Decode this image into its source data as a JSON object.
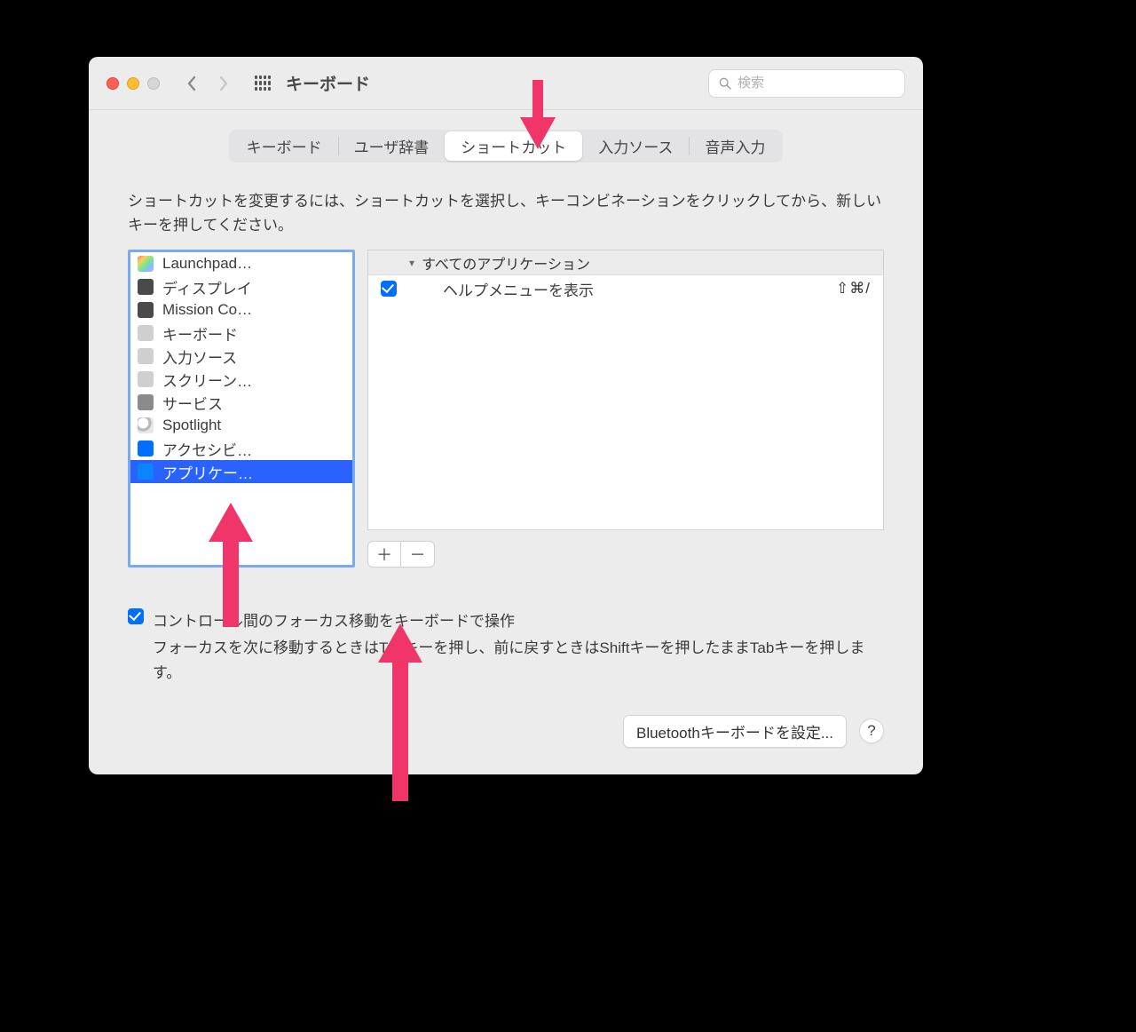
{
  "window": {
    "title": "キーボード",
    "search_placeholder": "検索"
  },
  "tabs": [
    {
      "label": "キーボード",
      "active": false
    },
    {
      "label": "ユーザ辞書",
      "active": false
    },
    {
      "label": "ショートカット",
      "active": true
    },
    {
      "label": "入力ソース",
      "active": false
    },
    {
      "label": "音声入力",
      "active": false
    }
  ],
  "instruction": "ショートカットを変更するには、ショートカットを選択し、キーコンビネーションをクリックしてから、新しいキーを押してください。",
  "sidebar": {
    "items": [
      {
        "label": "Launchpad…",
        "icon": "launchpad-icon",
        "icon_class": "ico-launchpad",
        "selected": false
      },
      {
        "label": "ディスプレイ",
        "icon": "display-icon",
        "icon_class": "ico-display",
        "selected": false
      },
      {
        "label": "Mission Co…",
        "icon": "mission-control-icon",
        "icon_class": "ico-mission",
        "selected": false
      },
      {
        "label": "キーボード",
        "icon": "keyboard-icon",
        "icon_class": "ico-keyboard",
        "selected": false
      },
      {
        "label": "入力ソース",
        "icon": "input-source-icon",
        "icon_class": "ico-input",
        "selected": false
      },
      {
        "label": "スクリーン…",
        "icon": "screenshot-icon",
        "icon_class": "ico-screen",
        "selected": false
      },
      {
        "label": "サービス",
        "icon": "services-icon",
        "icon_class": "ico-services",
        "selected": false
      },
      {
        "label": "Spotlight",
        "icon": "spotlight-icon",
        "icon_class": "ico-spotlight",
        "selected": false
      },
      {
        "label": "アクセシビ…",
        "icon": "accessibility-icon",
        "icon_class": "ico-access",
        "selected": false
      },
      {
        "label": "アプリケー…",
        "icon": "app-shortcuts-icon",
        "icon_class": "ico-app",
        "selected": true
      }
    ]
  },
  "shortcuts": {
    "group_label": "すべてのアプリケーション",
    "items": [
      {
        "enabled": true,
        "label": "ヘルプメニューを表示",
        "keys": "⇧⌘/"
      }
    ]
  },
  "footer": {
    "checkbox_label": "コントロール間のフォーカス移動をキーボードで操作",
    "description": "フォーカスを次に移動するときはTabキーを押し、前に戻すときはShiftキーを押したままTabキーを押します。"
  },
  "bottom": {
    "bluetooth_label": "Bluetoothキーボードを設定...",
    "help_label": "?"
  }
}
